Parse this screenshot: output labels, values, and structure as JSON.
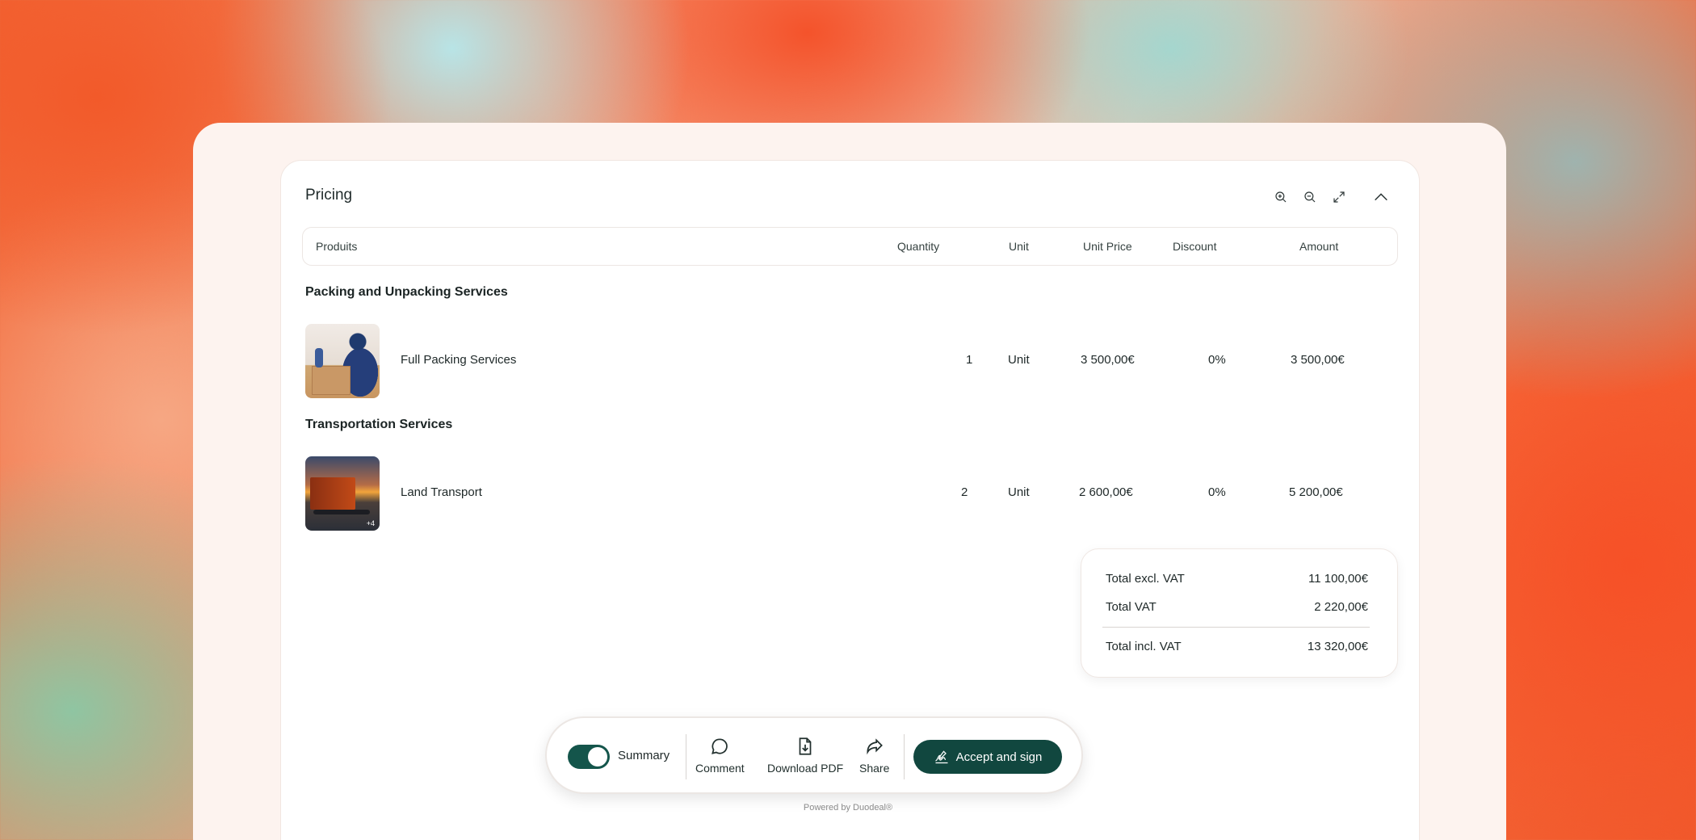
{
  "pricing": {
    "title": "Pricing",
    "columns": {
      "products": "Produits",
      "quantity": "Quantity",
      "unit": "Unit",
      "unit_price": "Unit Price",
      "discount": "Discount",
      "amount": "Amount"
    },
    "sections": [
      {
        "title": "Packing and Unpacking Services",
        "items": [
          {
            "name": "Full Packing Services",
            "quantity": "1",
            "unit": "Unit",
            "unit_price": "3 500,00€",
            "discount": "0%",
            "amount": "3 500,00€"
          }
        ]
      },
      {
        "title": "Transportation Services",
        "items": [
          {
            "name": "Land Transport",
            "quantity": "2",
            "unit": "Unit",
            "unit_price": "2 600,00€",
            "discount": "0%",
            "amount": "5 200,00€",
            "image_badge": "+4"
          }
        ]
      }
    ],
    "totals": {
      "excl_label": "Total excl. VAT",
      "excl_value": "11 100,00€",
      "vat_label": "Total VAT",
      "vat_value": "2 220,00€",
      "incl_label": "Total incl. VAT",
      "incl_value": "13 320,00€"
    },
    "tool_icons": [
      "zoom-in-icon",
      "zoom-out-icon",
      "expand-icon",
      "chevron-up-icon"
    ]
  },
  "action_bar": {
    "summary_label": "Summary",
    "summary_enabled": true,
    "comment_label": "Comment",
    "download_label": "Download PDF",
    "share_label": "Share",
    "accept_label": "Accept and sign"
  },
  "footer": {
    "powered_by": "Powered by Duodeal®"
  },
  "colors": {
    "primary": "#11473f",
    "card_bg": "#fdf3ef",
    "accent_orange": "#f25a2a"
  }
}
